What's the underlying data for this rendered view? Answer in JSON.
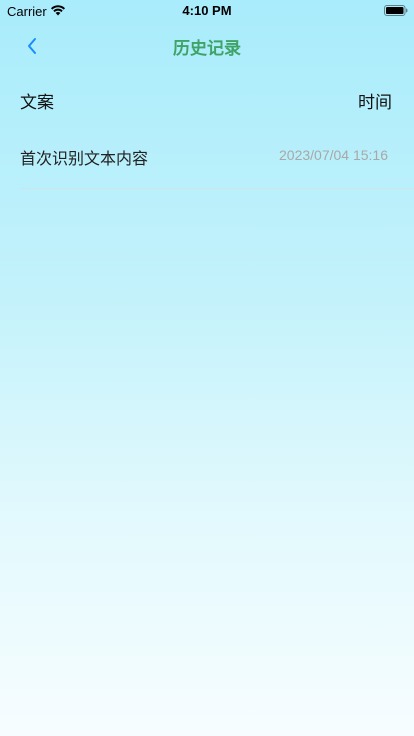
{
  "status_bar": {
    "carrier": "Carrier",
    "time": "4:10 PM"
  },
  "nav": {
    "title": "历史记录",
    "back_icon": "chevron-left-icon",
    "title_color": "#3fa368",
    "back_color": "#1a8cff"
  },
  "table": {
    "headers": {
      "content": "文案",
      "time": "时间"
    },
    "rows": [
      {
        "content": "首次识别文本内容",
        "time": "2023/07/04 15:16"
      }
    ]
  }
}
